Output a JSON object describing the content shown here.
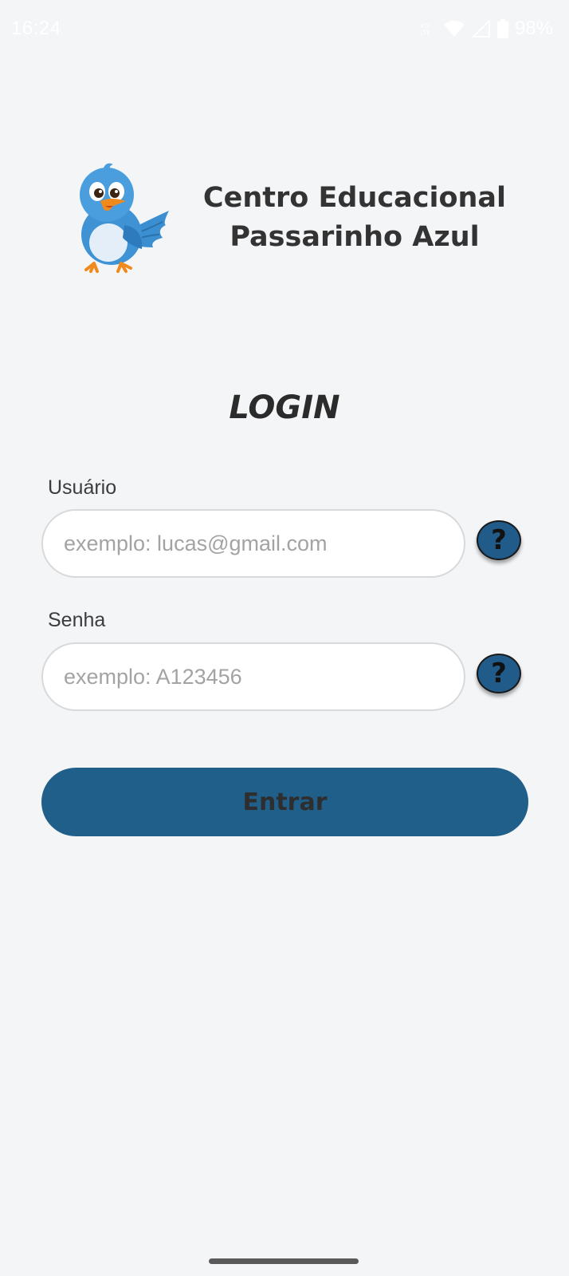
{
  "status_bar": {
    "time": "16:24",
    "battery": "98%",
    "icons": [
      "lte-icon",
      "wifi-icon",
      "signal-icon",
      "battery-icon"
    ]
  },
  "header": {
    "logo": "bird-mascot-logo",
    "school_name_line1": "Centro Educacional",
    "school_name_line2": "Passarinho Azul"
  },
  "login": {
    "title": "LOGIN",
    "username": {
      "label": "Usuário",
      "placeholder": "exemplo: lucas@gmail.com",
      "value": "",
      "help": "?"
    },
    "password": {
      "label": "Senha",
      "placeholder": "exemplo: A123456",
      "value": "",
      "help": "?"
    },
    "submit_label": "Entrar"
  },
  "colors": {
    "background": "#f4f5f7",
    "primary": "#215f8b",
    "text": "#333333",
    "placeholder": "#a3a3a3"
  }
}
